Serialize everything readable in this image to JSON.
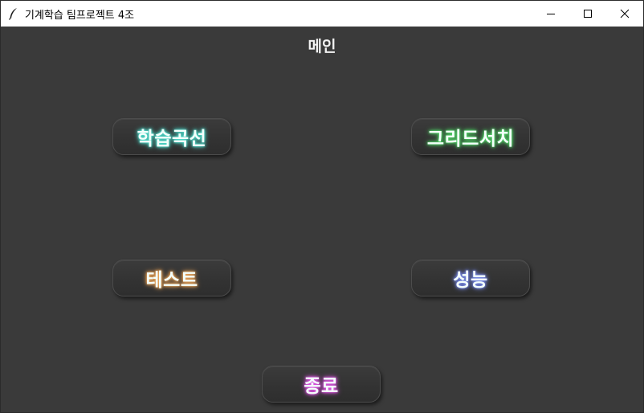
{
  "window": {
    "title": "기계학습 팀프로젝트 4조",
    "icon": "feather-icon",
    "controls": [
      "minimize-icon",
      "maximize-icon",
      "close-icon"
    ]
  },
  "main": {
    "label": "메인"
  },
  "buttons": {
    "learning_curve": {
      "label": "학습곡선",
      "glow_color": "#4fe3d3"
    },
    "grid_search": {
      "label": "그리드서치",
      "glow_color": "#52e06a"
    },
    "test": {
      "label": "테스트",
      "glow_color": "#f2a85a"
    },
    "performance": {
      "label": "성능",
      "glow_color": "#7a8cf0"
    },
    "exit": {
      "label": "종료",
      "glow_color": "#e257e8"
    }
  }
}
